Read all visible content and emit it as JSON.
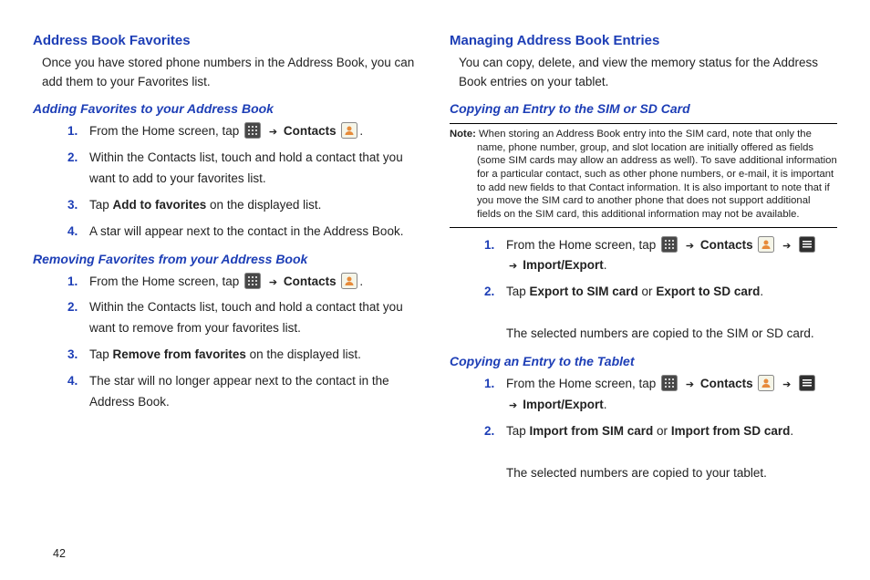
{
  "pageNumber": "42",
  "left": {
    "h1": "Address Book Favorites",
    "intro": "Once you have stored phone numbers in the Address Book, you can add them to your Favorites list.",
    "sec1": {
      "title": "Adding Favorites to your Address Book",
      "steps": {
        "1": {
          "pre": "From the Home screen, tap ",
          "post": "."
        },
        "2": "Within the Contacts list, touch and hold a contact that you want to add to your favorites list.",
        "3": {
          "a": "Tap ",
          "b": "Add to favorites",
          "c": " on the displayed list."
        },
        "4": "A star will appear next to the contact in the Address Book."
      }
    },
    "sec2": {
      "title": "Removing Favorites from your Address Book",
      "steps": {
        "1": {
          "pre": "From the Home screen, tap ",
          "post": "."
        },
        "2": "Within the Contacts list, touch and hold a contact that you want to remove from your favorites list.",
        "3": {
          "a": "Tap ",
          "b": "Remove from favorites",
          "c": " on the displayed list."
        },
        "4": "The star will no longer appear next to the contact in the Address Book."
      }
    }
  },
  "right": {
    "h1": "Managing Address Book Entries",
    "intro": "You can copy, delete, and view the memory status for the Address Book entries on your tablet.",
    "sec1": {
      "title": "Copying an Entry to the SIM or SD Card",
      "noteLabel": "Note:",
      "note": " When storing an Address Book entry into the SIM card, note that only the name, phone number, group, and slot location are initially offered as fields (some SIM cards may allow an address as well). To save additional information for a particular contact, such as other phone numbers, or e-mail, it is important to add new fields to that Contact information. It is also important to note that if you move the SIM card to another phone that does not support additional fields on the SIM card, this additional information may not be available.",
      "steps": {
        "1": {
          "pre": "From the Home screen, tap ",
          "sub": "Import/Export",
          "end": "."
        },
        "2": {
          "a": "Tap ",
          "b": "Export to SIM card",
          "c": " or ",
          "d": "Export to SD card",
          "e": ".",
          "f": "The selected numbers are copied to the SIM or SD card."
        }
      }
    },
    "sec2": {
      "title": "Copying an Entry to the Tablet",
      "steps": {
        "1": {
          "pre": "From the Home screen, tap ",
          "sub": "Import/Export",
          "end": "."
        },
        "2": {
          "a": "Tap ",
          "b": "Import from SIM card",
          "c": " or ",
          "d": "Import from SD card",
          "e": ".",
          "f": "The selected numbers are copied to your tablet."
        }
      }
    }
  },
  "labels": {
    "contacts": "Contacts",
    "arrow": "➔",
    "arrowPre": "➔ "
  }
}
